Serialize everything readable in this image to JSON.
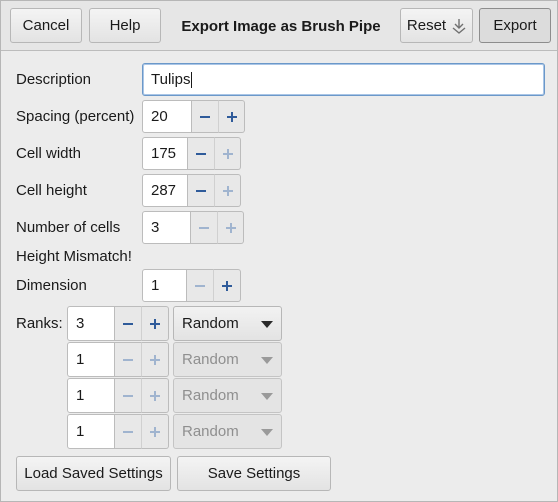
{
  "header": {
    "cancel_label": "Cancel",
    "help_label": "Help",
    "title": "Export Image as Brush Pipe",
    "reset_label": "Reset",
    "export_label": "Export"
  },
  "form": {
    "description": {
      "label": "Description",
      "value": "Tulips"
    },
    "spacing": {
      "label": "Spacing (percent)",
      "value": "20"
    },
    "cell_width": {
      "label": "Cell width",
      "value": "175"
    },
    "cell_height": {
      "label": "Cell height",
      "value": "287"
    },
    "num_cells": {
      "label": "Number of cells",
      "value": "3"
    },
    "mismatch_text": "Height Mismatch!",
    "dimension": {
      "label": "Dimension",
      "value": "1"
    },
    "ranks_label": "Ranks:",
    "ranks": [
      {
        "value": "3",
        "mode": "Random"
      },
      {
        "value": "1",
        "mode": "Random"
      },
      {
        "value": "1",
        "mode": "Random"
      },
      {
        "value": "1",
        "mode": "Random"
      }
    ]
  },
  "footer": {
    "load_label": "Load Saved Settings",
    "save_label": "Save Settings"
  },
  "icons": {
    "minus": "minus-icon",
    "plus": "plus-icon",
    "reset": "reset-arrow-icon"
  },
  "colors": {
    "active_icon": "#2f5b9a",
    "disabled_icon": "#a0b4cf"
  }
}
